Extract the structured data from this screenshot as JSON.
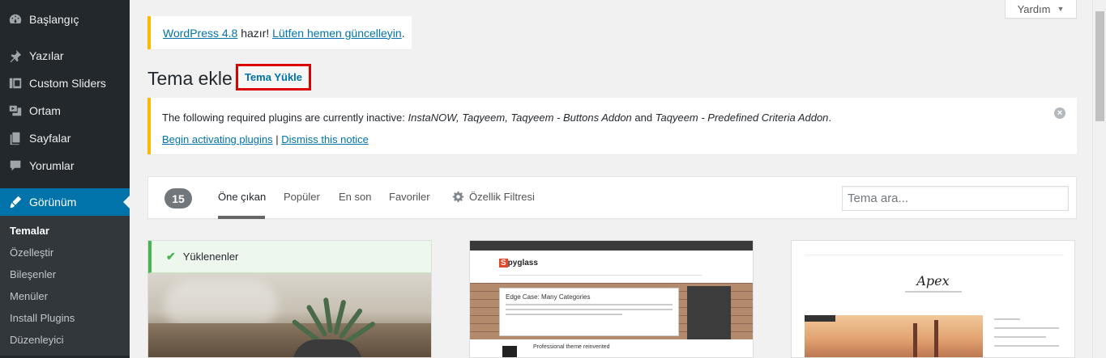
{
  "sidebar": {
    "items": [
      {
        "label": "Başlangıç",
        "icon": "dashboard-icon"
      },
      {
        "label": "Yazılar",
        "icon": "pin-icon"
      },
      {
        "label": "Custom Sliders",
        "icon": "slides-icon"
      },
      {
        "label": "Ortam",
        "icon": "media-icon"
      },
      {
        "label": "Sayfalar",
        "icon": "pages-icon"
      },
      {
        "label": "Yorumlar",
        "icon": "comments-icon"
      }
    ],
    "active": {
      "label": "Görünüm",
      "icon": "appearance-icon"
    },
    "submenu": [
      {
        "label": "Temalar",
        "current": true
      },
      {
        "label": "Özelleştir"
      },
      {
        "label": "Bileşenler"
      },
      {
        "label": "Menüler"
      },
      {
        "label": "Install Plugins"
      },
      {
        "label": "Düzenleyici"
      }
    ]
  },
  "help_tab": {
    "label": "Yardım"
  },
  "update_nag": {
    "version_link": "WordPress 4.8",
    "middle": "hazır!",
    "update_link": "Lütfen hemen güncelleyin",
    "end": "."
  },
  "page": {
    "title": "Tema ekle",
    "upload_button": "Tema Yükle"
  },
  "plugin_notice": {
    "prefix": "The following required plugins are currently inactive:",
    "plugins_a": "InstaNOW, Taqyeem, Taqyeem - Buttons Addon",
    "and": "and",
    "plugins_b": "Taqyeem - Predefined Criteria Addon",
    "dot": ".",
    "begin_link": "Begin activating plugins",
    "separator": "|",
    "dismiss_link": "Dismiss this notice"
  },
  "filter_bar": {
    "count": "15",
    "tabs": [
      "Öne çıkan",
      "Popüler",
      "En son",
      "Favoriler"
    ],
    "feature_filter": "Özellik Filtresi",
    "search_placeholder": "Tema ara..."
  },
  "themes": {
    "installed_label": "Yüklenenler",
    "spyglass_logo_mark": "S",
    "spyglass_logo_rest": "pyglass",
    "spyglass_post_title": "Edge Case: Many Categories",
    "spyglass_post_2": "Professional theme reinvented",
    "apex_title": "Apex"
  },
  "colors": {
    "sidebar_bg": "#23282d",
    "active_menu": "#0073aa",
    "link": "#0073aa",
    "notice_border": "#ffba00",
    "installed_green": "#46b450",
    "highlight_red": "#dd0000"
  }
}
